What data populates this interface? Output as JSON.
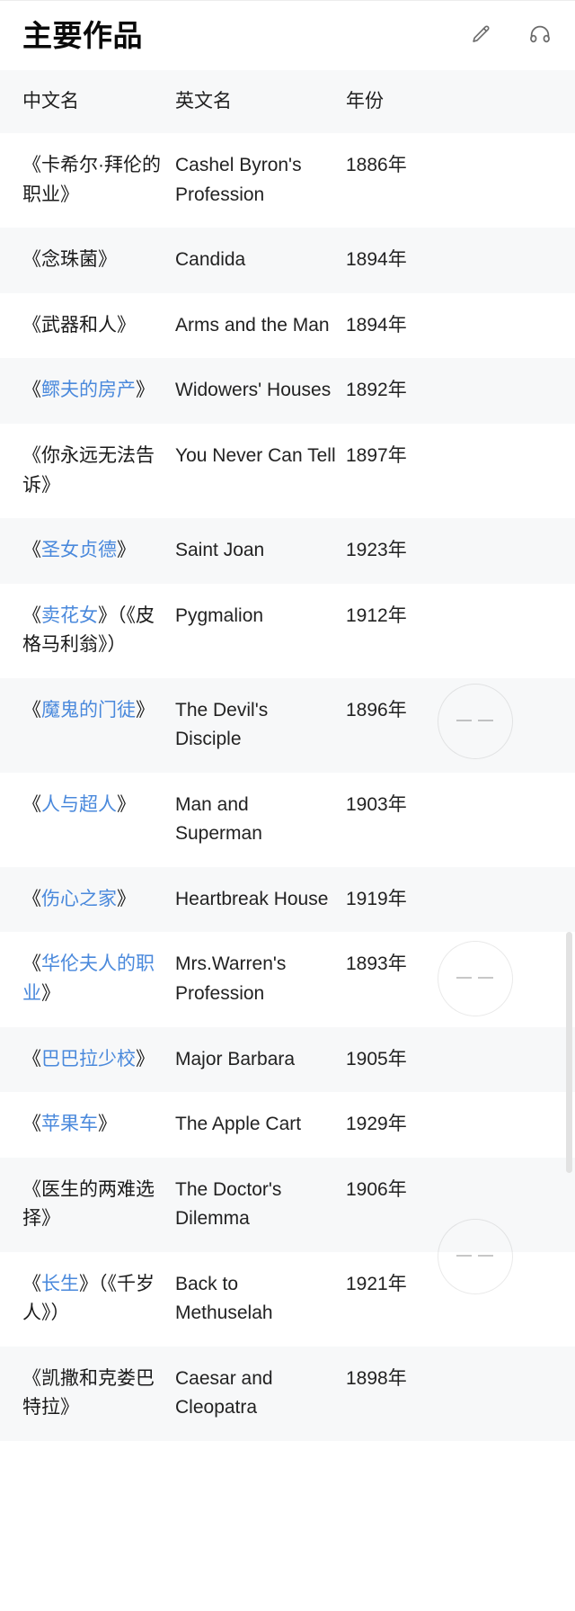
{
  "header": {
    "title": "主要作品",
    "actions": [
      {
        "name": "edit-icon",
        "label": "编辑"
      },
      {
        "name": "headphones-icon",
        "label": "听"
      }
    ]
  },
  "table": {
    "columns": [
      "中文名",
      "英文名",
      "年份"
    ],
    "rows": [
      {
        "cn_prefix": "《",
        "cn_link": "",
        "cn_plain": "卡希尔·拜伦的职业》",
        "cn_full": "《卡希尔·拜伦的职业》",
        "en": "Cashel Byron's Profession",
        "year": "1886年",
        "linked": false
      },
      {
        "cn_prefix": "《",
        "cn_link": "",
        "cn_plain": "念珠菌》",
        "cn_full": "《念珠菌》",
        "en": "Candida",
        "year": "1894年",
        "linked": false
      },
      {
        "cn_prefix": "《",
        "cn_link": "",
        "cn_plain": "武器和人》",
        "cn_full": "《武器和人》",
        "en": "Arms and the Man",
        "year": "1894年",
        "linked": false
      },
      {
        "cn_prefix": "《",
        "cn_link": "鳏夫的房产",
        "cn_plain": "》",
        "cn_full": "《鳏夫的房产》",
        "en": "Widowers' Houses",
        "year": "1892年",
        "linked": true
      },
      {
        "cn_prefix": "《",
        "cn_link": "",
        "cn_plain": "你永远无法告诉》",
        "cn_full": "《你永远无法告诉》",
        "en": "You Never Can Tell",
        "year": "1897年",
        "linked": false
      },
      {
        "cn_prefix": "《",
        "cn_link": "圣女贞德",
        "cn_plain": "》",
        "cn_full": "《圣女贞德》",
        "en": "Saint Joan",
        "year": "1923年",
        "linked": true
      },
      {
        "cn_prefix": "《",
        "cn_link": "卖花女",
        "cn_plain": "》（《皮格马利翁》）",
        "cn_full": "《卖花女》（《皮格马利翁》）",
        "en": "Pygmalion",
        "year": "1912年",
        "linked": true
      },
      {
        "cn_prefix": "《",
        "cn_link": "魔鬼的门徒",
        "cn_plain": "》",
        "cn_full": "《魔鬼的门徒》",
        "en": "The Devil's Disciple",
        "year": "1896年",
        "linked": true
      },
      {
        "cn_prefix": "《",
        "cn_link": "人与超人",
        "cn_plain": "》",
        "cn_full": "《人与超人》",
        "en": "Man and Superman",
        "year": "1903年",
        "linked": true
      },
      {
        "cn_prefix": "《",
        "cn_link": "伤心之家",
        "cn_plain": "》",
        "cn_full": "《伤心之家》",
        "en": "Heartbreak House",
        "year": "1919年",
        "linked": true
      },
      {
        "cn_prefix": "《",
        "cn_link": "华伦夫人的职业",
        "cn_plain": "》",
        "cn_full": "《华伦夫人的职业》",
        "en": "Mrs.Warren's Profession",
        "year": "1893年",
        "linked": true
      },
      {
        "cn_prefix": "《",
        "cn_link": "巴巴拉少校",
        "cn_plain": "》",
        "cn_full": "《巴巴拉少校》",
        "en": "Major Barbara",
        "year": "1905年",
        "linked": true
      },
      {
        "cn_prefix": "《",
        "cn_link": "苹果车",
        "cn_plain": "》",
        "cn_full": "《苹果车》",
        "en": "The Apple Cart",
        "year": "1929年",
        "linked": true
      },
      {
        "cn_prefix": "《",
        "cn_link": "",
        "cn_plain": "医生的两难选择》",
        "cn_full": "《医生的两难选择》",
        "en": "The Doctor's Dilemma",
        "year": "1906年",
        "linked": false
      },
      {
        "cn_prefix": "《",
        "cn_link": "长生",
        "cn_plain": "》（《千岁人》）",
        "cn_full": "《长生》（《千岁人》）",
        "en": "Back to Methuselah",
        "year": "1921年",
        "linked": true
      },
      {
        "cn_prefix": "《",
        "cn_link": "",
        "cn_plain": "凯撒和克娄巴特拉》",
        "cn_full": "《凯撒和克娄巴特拉》",
        "en": "Caesar and Cleopatra",
        "year": "1898年",
        "linked": false
      }
    ]
  },
  "colors": {
    "link": "#4a89dc",
    "text": "#222222",
    "row_alt_bg": "#f7f8f9",
    "row_bg": "#ffffff",
    "scrollbar": "#e2e2e2"
  },
  "scrollbar": {
    "visible": true
  }
}
